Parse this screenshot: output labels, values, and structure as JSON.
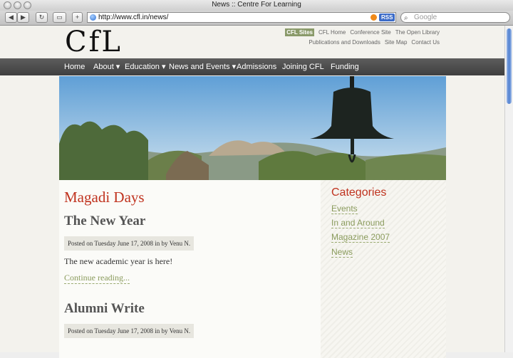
{
  "window": {
    "title": "News :: Centre For Learning"
  },
  "toolbar": {
    "back": "◀",
    "forward": "▶",
    "reload": "↻",
    "bookmarks_glyph": "▭",
    "add_glyph": "+",
    "url": "http://www.cfl.in/news/",
    "rss_label": "RSS",
    "search_placeholder": "Google",
    "icons": [
      "globe-icon",
      "feed-icon",
      "search-icon"
    ]
  },
  "site": {
    "logo": "CfL",
    "top_links": [
      "CFL Sites",
      "CFL Home",
      "Conference Site",
      "The Open Library",
      "Publications and Downloads",
      "Site Map",
      "Contact Us"
    ],
    "nav": [
      {
        "label": "Home",
        "dropdown": false
      },
      {
        "label": "About",
        "dropdown": true
      },
      {
        "label": "Education",
        "dropdown": true
      },
      {
        "label": "News and Events",
        "dropdown": true
      },
      {
        "label": "Admissions",
        "dropdown": false
      },
      {
        "label": "Joining CFL",
        "dropdown": false
      },
      {
        "label": "Funding",
        "dropdown": false
      }
    ]
  },
  "main": {
    "section_title": "Magadi Days",
    "posts": [
      {
        "title": "The New Year",
        "meta": "Posted on Tuesday June 17, 2008 in by Venu N.",
        "excerpt": "The new academic year is here!",
        "more": "Continue reading..."
      },
      {
        "title": "Alumni Write",
        "meta": "Posted on Tuesday June 17, 2008 in by Venu N."
      }
    ]
  },
  "sidebar": {
    "title": "Categories",
    "items": [
      "Events",
      "In and Around",
      "Magazine 2007",
      "News"
    ]
  },
  "colors": {
    "accent": "#c0331f",
    "link": "#8a9b5c",
    "nav_bg": "#4a4a4a"
  }
}
